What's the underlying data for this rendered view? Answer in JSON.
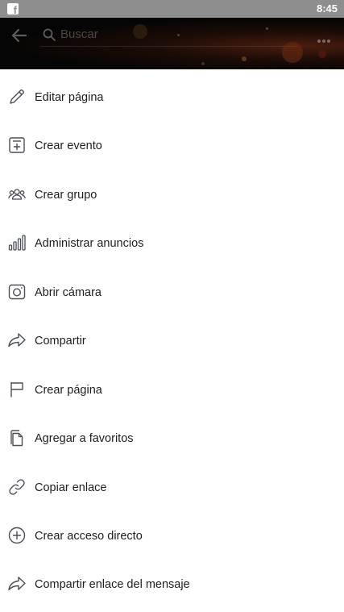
{
  "status_bar": {
    "app_icon": "facebook-icon",
    "time": "8:45"
  },
  "header": {
    "search_placeholder": "Buscar",
    "background": "#050505"
  },
  "menu": {
    "items": [
      {
        "label": "Editar página",
        "icon": "pencil-icon"
      },
      {
        "label": "Crear evento",
        "icon": "calendar-plus-icon"
      },
      {
        "label": "Crear grupo",
        "icon": "group-icon"
      },
      {
        "label": "Administrar anuncios",
        "icon": "bar-chart-icon"
      },
      {
        "label": "Abrir cámara",
        "icon": "camera-icon"
      },
      {
        "label": "Compartir",
        "icon": "share-arrow-icon"
      },
      {
        "label": "Crear página",
        "icon": "flag-icon"
      },
      {
        "label": "Agregar a favoritos",
        "icon": "bookmark-pages-icon"
      },
      {
        "label": "Copiar enlace",
        "icon": "link-icon"
      },
      {
        "label": "Crear acceso directo",
        "icon": "plus-circle-icon"
      },
      {
        "label": "Compartir enlace del mensaje",
        "icon": "share-arrow-icon"
      }
    ]
  },
  "colors": {
    "text": "#1c1e21",
    "icon_stroke": "#4b4f56",
    "status_bar": "#8e8e8e"
  }
}
